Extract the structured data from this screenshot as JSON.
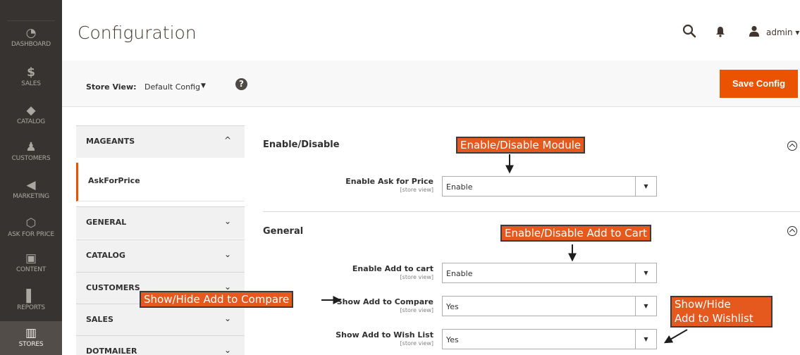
{
  "nav": {
    "items": [
      {
        "icon": "dashboard-icon",
        "glyph": "◔",
        "label": "DASHBOARD"
      },
      {
        "icon": "sales-icon",
        "glyph": "$",
        "label": "SALES"
      },
      {
        "icon": "catalog-icon",
        "glyph": "◆",
        "label": "CATALOG"
      },
      {
        "icon": "customers-icon",
        "glyph": "♟",
        "label": "CUSTOMERS"
      },
      {
        "icon": "marketing-icon",
        "glyph": "◀",
        "label": "MARKETING"
      },
      {
        "icon": "ask-for-price-icon",
        "glyph": "⬡",
        "label": "ASK FOR PRICE"
      },
      {
        "icon": "content-icon",
        "glyph": "▣",
        "label": "CONTENT"
      },
      {
        "icon": "reports-icon",
        "glyph": "▌",
        "label": "REPORTS"
      },
      {
        "icon": "stores-icon",
        "glyph": "▥",
        "label": "STORES"
      }
    ]
  },
  "header": {
    "title": "Configuration",
    "user": "admin ▾"
  },
  "store_view": {
    "label": "Store View:",
    "value": "Default Config",
    "caret": "▼",
    "help": "?",
    "save_label": "Save Config"
  },
  "sidebar": {
    "groups": [
      {
        "label": "MAGEANTS",
        "chevron": "^"
      },
      {
        "label": "GENERAL",
        "chevron": "⌄"
      },
      {
        "label": "CATALOG",
        "chevron": "⌄"
      },
      {
        "label": "CUSTOMERS",
        "chevron": "⌄"
      },
      {
        "label": "SALES",
        "chevron": "⌄"
      },
      {
        "label": "DOTMAILER",
        "chevron": "⌄"
      }
    ],
    "active_sub": "AskForPrice"
  },
  "sections": [
    {
      "title": "Enable/Disable",
      "fields": [
        {
          "label": "Enable Ask for Price",
          "scope": "[store view]",
          "value": "Enable"
        }
      ]
    },
    {
      "title": "General",
      "fields": [
        {
          "label": "Enable Add to cart",
          "scope": "[store view]",
          "value": "Enable"
        },
        {
          "label": "Show Add to Compare",
          "scope": "[store view]",
          "value": "Yes"
        },
        {
          "label": "Show Add to Wish List",
          "scope": "[store view]",
          "value": "Yes"
        }
      ]
    }
  ],
  "annotations": {
    "enable_module": "Enable/Disable Module",
    "enable_cart": "Enable/Disable Add to Cart",
    "compare": "Show/Hide Add to Compare",
    "wishlist_line1": "Show/Hide",
    "wishlist_line2": "Add to Wishlist"
  },
  "colors": {
    "accent": "#eb5202",
    "nav_bg": "#373330",
    "callout": "#e5591e"
  }
}
